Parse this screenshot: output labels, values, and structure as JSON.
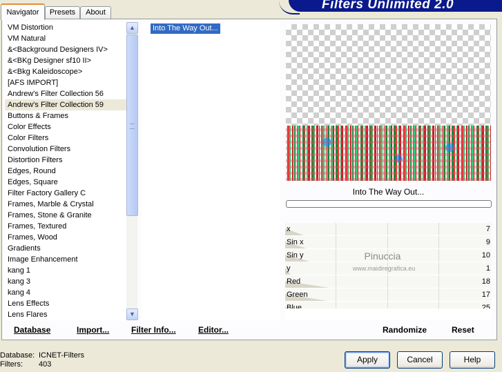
{
  "tabs": [
    {
      "label": "Navigator",
      "active": true
    },
    {
      "label": "Presets",
      "active": false
    },
    {
      "label": "About",
      "active": false
    }
  ],
  "banner_title": "Filters Unlimited 2.0",
  "categories": [
    "VM Distortion",
    "VM Natural",
    "&<Background Designers IV>",
    "&<BKg Designer sf10 II>",
    "&<Bkg Kaleidoscope>",
    "[AFS IMPORT]",
    "Andrew's Filter Collection 56",
    "Andrew's Filter Collection 59",
    "Buttons & Frames",
    "Color Effects",
    "Color Filters",
    "Convolution Filters",
    "Distortion Filters",
    "Edges, Round",
    "Edges, Square",
    "Filter Factory Gallery C",
    "Frames, Marble & Crystal",
    "Frames, Stone & Granite",
    "Frames, Textured",
    "Frames, Wood",
    "Gradients",
    "Image Enhancement",
    "kang 1",
    "kang 3",
    "kang 4",
    "Lens Effects",
    "Lens Flares"
  ],
  "selected_category": "Andrew's Filter Collection 59",
  "filters": [
    "Into The Way Out..."
  ],
  "current_filter": "Into The Way Out...",
  "parameters": [
    {
      "label": "x",
      "value": "7",
      "level": 0.03
    },
    {
      "label": "Sin x",
      "value": "9",
      "level": 0.035
    },
    {
      "label": "Sin y",
      "value": "10",
      "level": 0.04
    },
    {
      "label": "y",
      "value": "1",
      "level": 0.004
    },
    {
      "label": "Red",
      "value": "18",
      "level": 0.07
    },
    {
      "label": "Green",
      "value": "17",
      "level": 0.067
    },
    {
      "label": "Blue",
      "value": "25",
      "level": 0.1
    }
  ],
  "watermark": {
    "title": "Pinuccia",
    "subtitle": "www.maidiregrafica.eu"
  },
  "toolbar": {
    "database": "Database",
    "import": "Import...",
    "filter_info": "Filter Info...",
    "editor": "Editor...",
    "randomize": "Randomize",
    "reset": "Reset"
  },
  "footer": {
    "database_label": "Database:",
    "database_value": "ICNET-Filters",
    "filters_label": "Filters:",
    "filters_value": "403"
  },
  "buttons": {
    "apply": "Apply",
    "cancel": "Cancel",
    "help": "Help"
  },
  "colors": {
    "accent_tab": "#e68b2c",
    "banner": "#0a1a8c",
    "selection": "#316ac5"
  }
}
